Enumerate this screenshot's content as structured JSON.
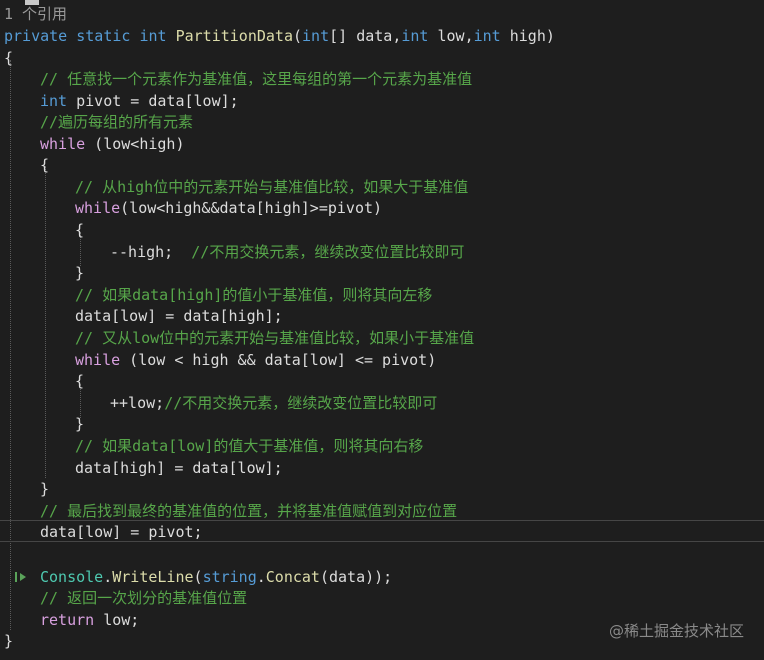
{
  "references": "1 个引用",
  "code": {
    "signature": {
      "mod1": "private",
      "mod2": "static",
      "ret": "int",
      "name": "PartitionData",
      "open": "(",
      "t1": "int",
      "p1": "[] data,",
      "t2": "int",
      "p2": " low,",
      "t3": "int",
      "p3": " high)"
    },
    "brace_open": "{",
    "cmt_pivot": "// 任意找一个元素作为基准值，这里每组的第一个元素为基准值",
    "pivot_type": "int",
    "pivot_rest": " pivot = data[low];",
    "cmt_traverse": "//遍历每组的所有元素",
    "while1_kw": "while",
    "while1_rest": " (low<high)",
    "brace_open2": "{",
    "cmt_high": "// 从high位中的元素开始与基准值比较，如果大于基准值",
    "while2_kw": "while",
    "while2_rest": "(low<high&&data[high]>=pivot)",
    "brace_open3": "{",
    "dec_high": "--high;",
    "dec_high_cmt": "//不用交换元素，继续改变位置比较即可",
    "brace_close3": "}",
    "cmt_if_less": "// 如果data[high]的值小于基准值，则将其向左移",
    "assign_low": "data[low] = data[high];",
    "cmt_low": "// 又从low位中的元素开始与基准值比较，如果小于基准值",
    "while3_kw": "while",
    "while3_rest": " (low < high && data[low] <= pivot)",
    "brace_open4": "{",
    "inc_low": "++low;",
    "inc_low_cmt": "//不用交换元素，继续改变位置比较即可",
    "brace_close4": "}",
    "cmt_if_greater": "// 如果data[low]的值大于基准值，则将其向右移",
    "assign_high": "data[high] = data[low];",
    "brace_close2": "}",
    "cmt_final": "// 最后找到最终的基准值的位置，并将基准值赋值到对应位置",
    "assign_pivot": "data[low] = pivot;",
    "console_type": "Console",
    "dot1": ".",
    "writeline": "WriteLine",
    "paren_open": "(",
    "string_kw": "string",
    "dot2": ".",
    "concat": "Concat",
    "concat_rest": "(data));",
    "cmt_return": "// 返回一次划分的基准值位置",
    "return_kw": "return",
    "return_rest": " low;",
    "brace_close": "}"
  },
  "watermark": "@稀土掘金技术社区",
  "colors": {
    "background": "#1e1e1e",
    "keyword": "#569cd6",
    "control_keyword": "#d8a0df",
    "type": "#4ec9b0",
    "method": "#dcdcaa",
    "comment": "#57a64a",
    "text": "#dcdcdc"
  }
}
